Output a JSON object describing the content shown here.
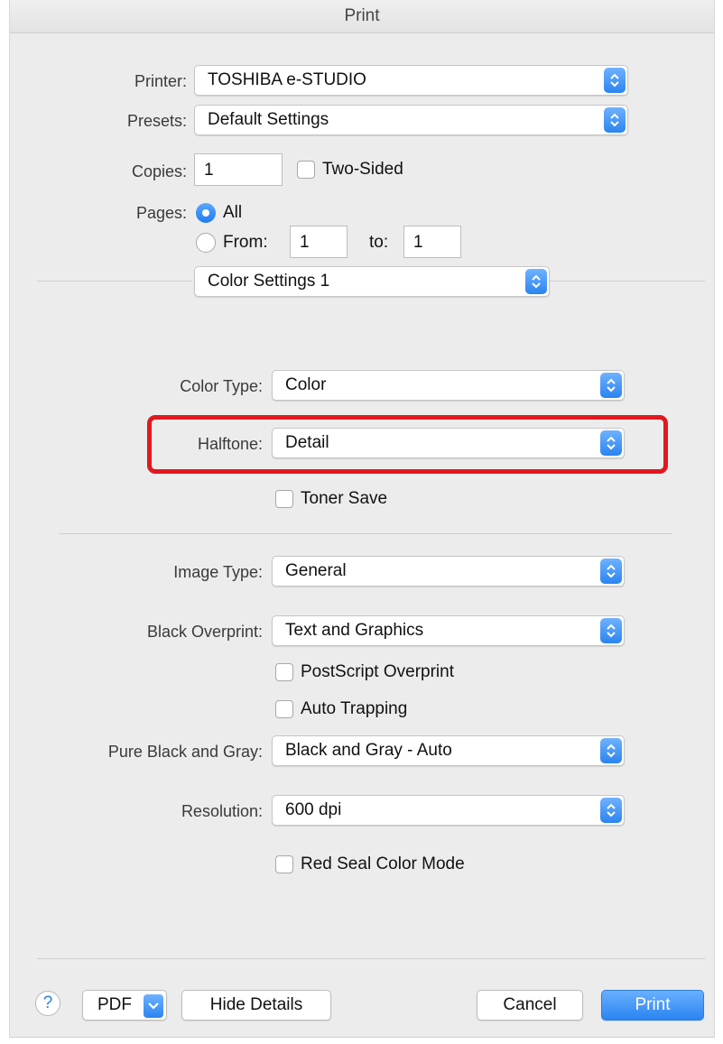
{
  "window": {
    "title": "Print"
  },
  "printer": {
    "label": "Printer:",
    "value": "TOSHIBA e-STUDIO"
  },
  "presets": {
    "label": "Presets:",
    "value": "Default Settings"
  },
  "copies": {
    "label": "Copies:",
    "value": "1",
    "two_sided_label": "Two-Sided",
    "two_sided_checked": false
  },
  "pages": {
    "label": "Pages:",
    "all_label": "All",
    "all_selected": true,
    "from_label": "From:",
    "from_value": "1",
    "to_label": "to:",
    "to_value": "1"
  },
  "panel_select": {
    "value": "Color Settings 1"
  },
  "color_type": {
    "label": "Color Type:",
    "value": "Color"
  },
  "halftone": {
    "label": "Halftone:",
    "value": "Detail"
  },
  "toner_save": {
    "label": "Toner Save",
    "checked": false
  },
  "image_type": {
    "label": "Image Type:",
    "value": "General"
  },
  "black_overprint": {
    "label": "Black Overprint:",
    "value": "Text and Graphics"
  },
  "postscript_overprint": {
    "label": "PostScript Overprint",
    "checked": false
  },
  "auto_trapping": {
    "label": "Auto Trapping",
    "checked": false
  },
  "pure_black_gray": {
    "label": "Pure Black and Gray:",
    "value": "Black and Gray - Auto"
  },
  "resolution": {
    "label": "Resolution:",
    "value": "600 dpi"
  },
  "red_seal": {
    "label": "Red Seal Color Mode",
    "checked": false
  },
  "footer": {
    "help_glyph": "?",
    "pdf_label": "PDF",
    "hide_details_label": "Hide Details",
    "cancel_label": "Cancel",
    "print_label": "Print"
  },
  "colors": {
    "accent": "#2a84f0",
    "highlight": "#e0191f",
    "window_bg": "#ececec"
  }
}
